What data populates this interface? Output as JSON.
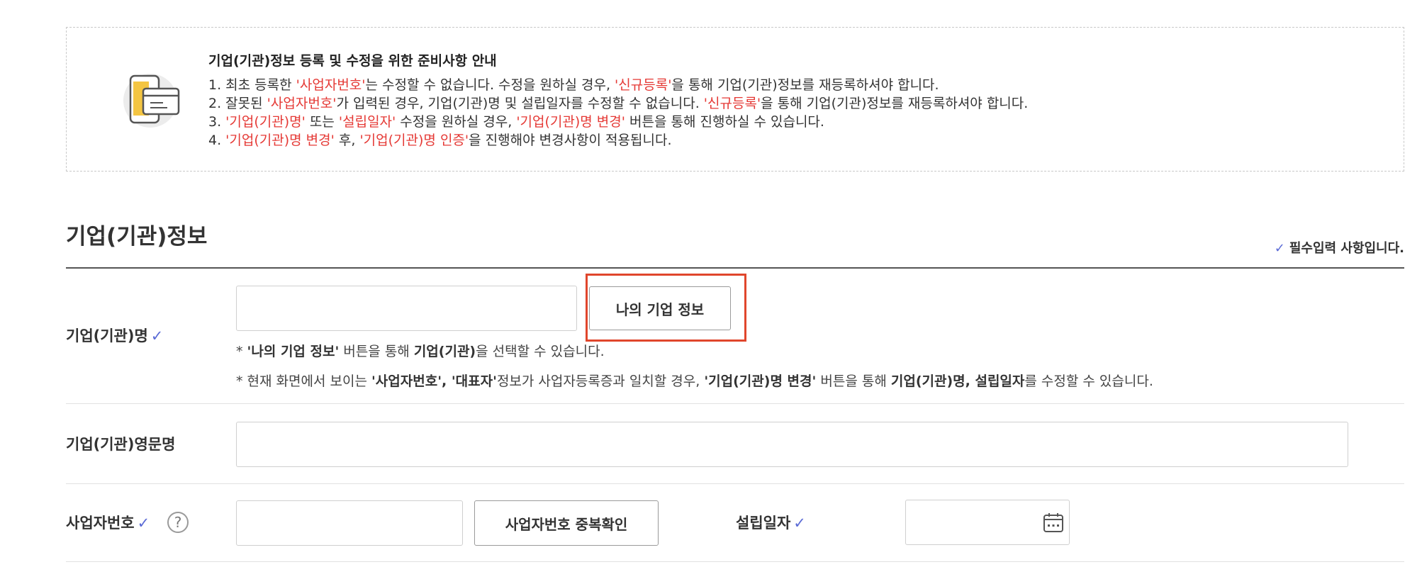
{
  "notice": {
    "title": "기업(기관)정보 등록 및 수정을 위한 준비사항 안내",
    "line1": {
      "p1": "1. 최초 등록한 ",
      "r1": "'사업자번호'",
      "p2": "는 수정할 수 없습니다. 수정을 원하실 경우, ",
      "r2": "'신규등록'",
      "p3": "을 통해 기업(기관)정보를 재등록하셔야 합니다."
    },
    "line2": {
      "p1": "2. 잘못된 ",
      "r1": "'사업자번호'",
      "p2": "가 입력된 경우, 기업(기관)명 및 설립일자를 수정할 수 없습니다. ",
      "r2": "'신규등록'",
      "p3": "을 통해 기업(기관)정보를 재등록하셔야 합니다."
    },
    "line3": {
      "p1": "3. ",
      "r1": "'기업(기관)명'",
      "p2": " 또는 ",
      "r2": "'설립일자'",
      "p3": " 수정을 원하실 경우, ",
      "r3": "'기업(기관)명 변경'",
      "p4": " 버튼을 통해 진행하실 수 있습니다."
    },
    "line4": {
      "p1": "4. ",
      "r1": "'기업(기관)명 변경'",
      "p2": " 후, ",
      "r2": "'기업(기관)명 인증'",
      "p3": "을 진행해야 변경사항이 적용됩니다."
    }
  },
  "section": {
    "title": "기업(기관)정보",
    "required_note": "필수입력 사항입니다.",
    "check_mark": "✓"
  },
  "fields": {
    "company_name": {
      "label": "기업(기관)명",
      "value": "",
      "button": "나의 기업 정보",
      "hint1": {
        "prefix": "* ",
        "b1": "'나의 기업 정보'",
        "t1": " 버튼을 통해 ",
        "b2": "기업(기관)",
        "t2": "을 선택할 수 있습니다."
      },
      "hint2": {
        "prefix": "* 현재 화면에서 보이는 ",
        "b1": "'사업자번호', '대표자'",
        "t1": "정보가 사업자등록증과 일치할 경우, ",
        "b2": "'기업(기관)명 변경'",
        "t2": " 버튼을 통해 ",
        "b3": "기업(기관)명, 설립일자",
        "t3": "를 수정할 수 있습니다."
      }
    },
    "company_name_en": {
      "label": "기업(기관)영문명",
      "value": ""
    },
    "business_number": {
      "label": "사업자번호",
      "value": "",
      "help": "?",
      "button": "사업자번호 중복확인"
    },
    "founding_date": {
      "label": "설립일자",
      "value": ""
    }
  },
  "colors": {
    "accent_red": "#e53935",
    "check_blue": "#5b6bd6",
    "highlight": "#e0462c"
  }
}
